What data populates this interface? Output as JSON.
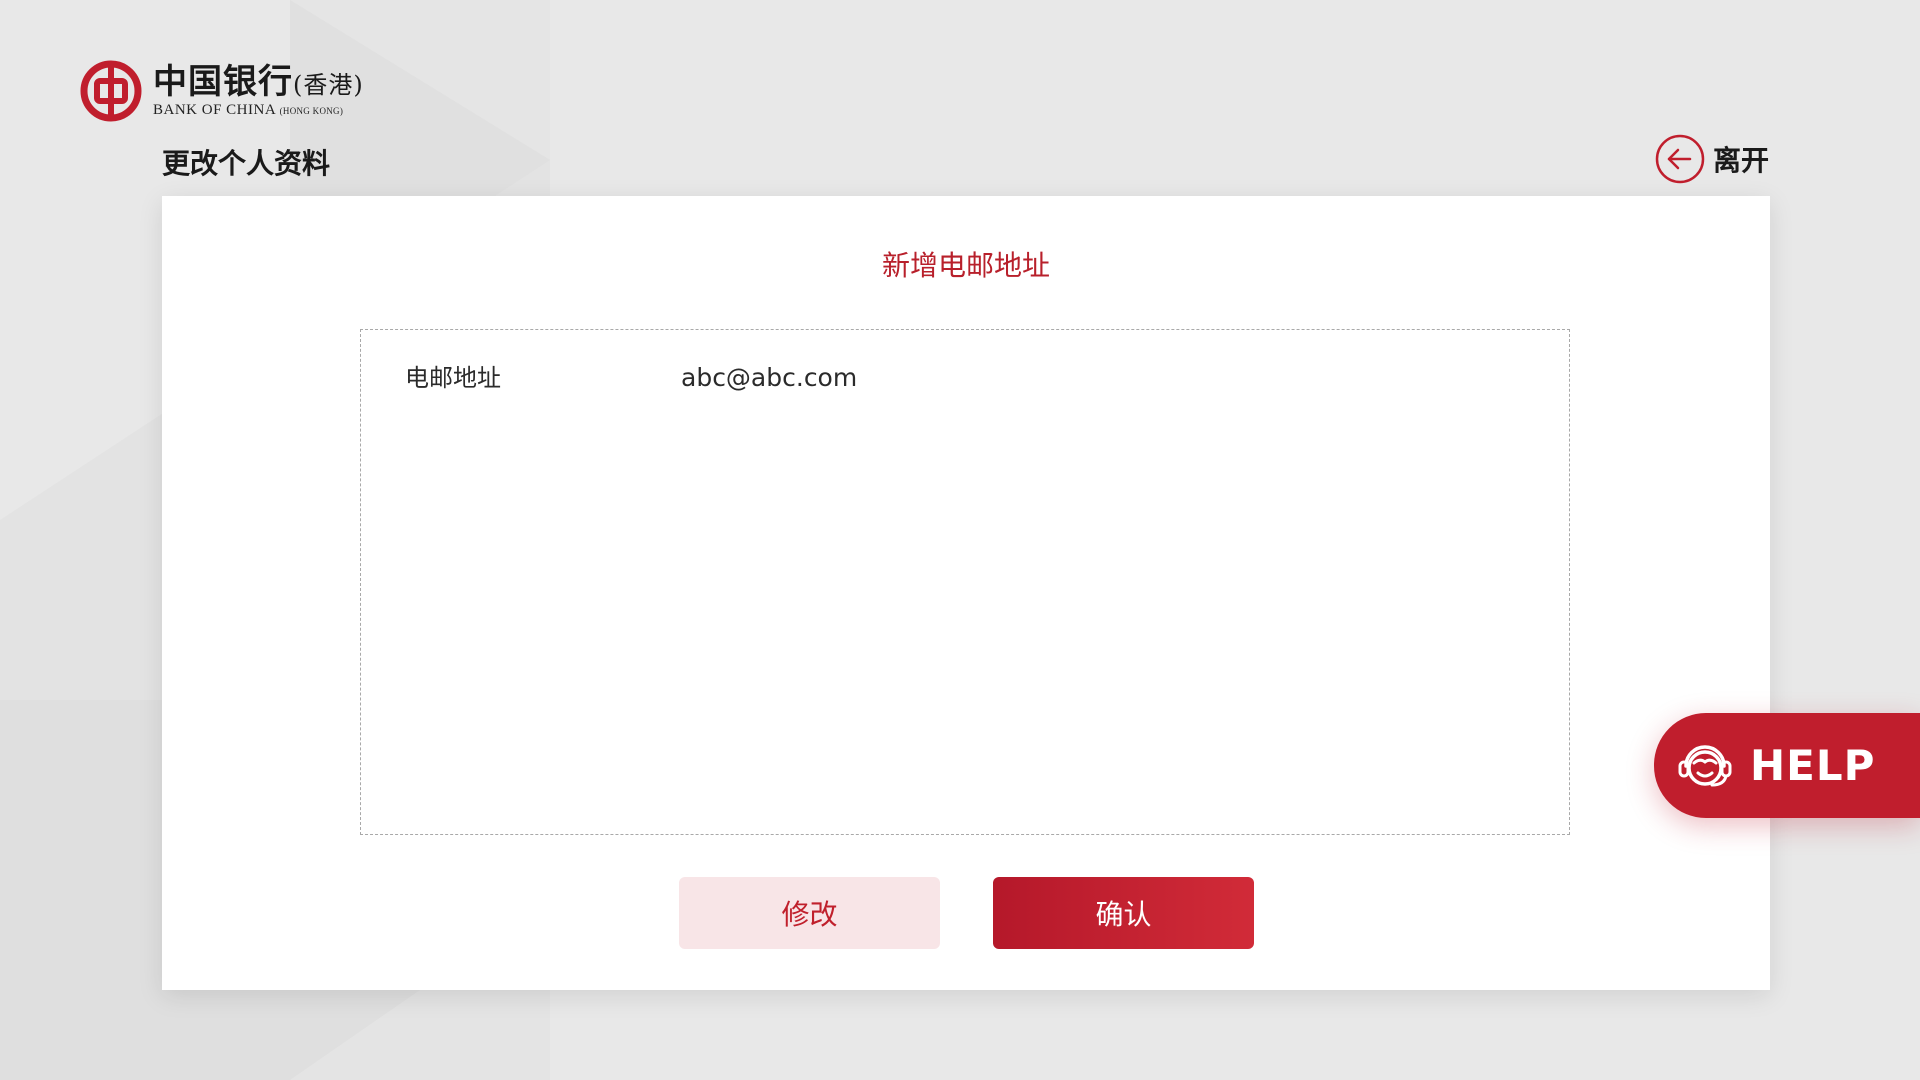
{
  "brand": {
    "name_cn": "中国银行",
    "region_cn": "(香港)",
    "name_en": "BANK OF CHINA",
    "region_en": "(HONG KONG)"
  },
  "header": {
    "page_title": "更改个人资料",
    "leave_label": "离开"
  },
  "dialog": {
    "title": "新增电邮地址",
    "fields": [
      {
        "label": "电邮地址",
        "value": "abc@abc.com"
      }
    ]
  },
  "actions": {
    "edit_label": "修改",
    "confirm_label": "确认"
  },
  "help": {
    "label": "HELP"
  },
  "colors": {
    "brand_red": "#c01e2d",
    "title_red": "#b8202b",
    "edit_bg": "#f8e5e7",
    "page_bg": "#e8e8e8"
  },
  "icons": {
    "logo": "bank-of-china-logo-icon",
    "leave": "arrow-left-circle-icon",
    "help": "headset-agent-icon"
  }
}
